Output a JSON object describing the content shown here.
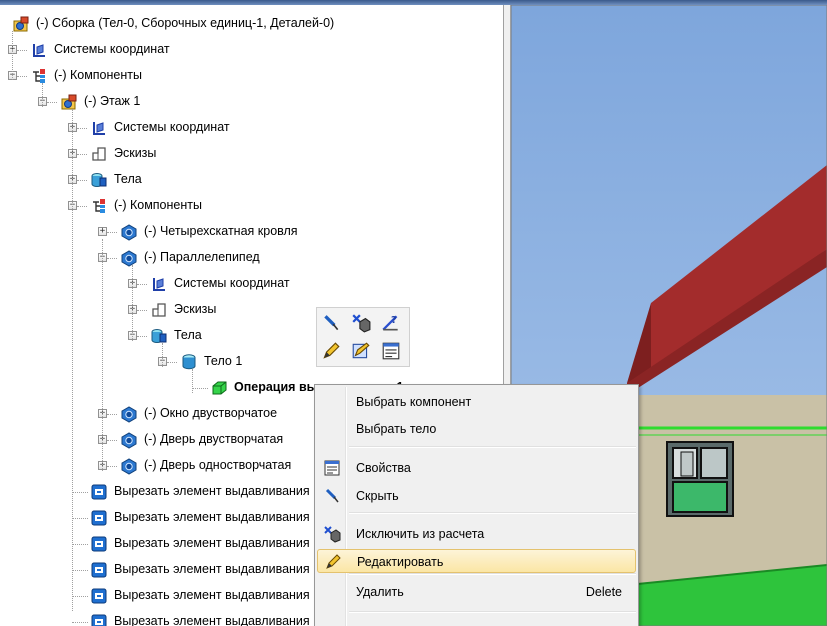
{
  "tree": {
    "root": "(-) Сборка (Тел-0, Сборочных единиц-1, Деталей-0)",
    "items": [
      {
        "label": "Системы координат"
      },
      {
        "label": "(-) Компоненты"
      },
      {
        "label": "(-) Этаж 1"
      },
      {
        "label": "Системы координат"
      },
      {
        "label": "Эскизы"
      },
      {
        "label": "Тела"
      },
      {
        "label": "(-) Компоненты"
      },
      {
        "label": "(-) Четырехскатная кровля"
      },
      {
        "label": "(-) Параллелепипед"
      },
      {
        "label": "Системы координат"
      },
      {
        "label": "Эскизы"
      },
      {
        "label": "Тела"
      },
      {
        "label": "Тело 1"
      },
      {
        "label": "Операция выдавливания:1"
      },
      {
        "label": "(-) Окно двустворчатое"
      },
      {
        "label": "(-) Дверь двустворчатая"
      },
      {
        "label": "(-) Дверь одностворчатая"
      },
      {
        "label": "Вырезать элемент выдавливания"
      },
      {
        "label": "Вырезать элемент выдавливания"
      },
      {
        "label": "Вырезать элемент выдавливания"
      },
      {
        "label": "Вырезать элемент выдавливания"
      },
      {
        "label": "Вырезать элемент выдавливания"
      },
      {
        "label": "Вырезать элемент выдавливания"
      }
    ]
  },
  "mini_toolbar": {
    "icons": [
      "pin-icon",
      "exclude-icon",
      "measure-icon",
      "pencil-icon",
      "edit-sketch-icon",
      "properties-icon"
    ]
  },
  "context_menu": {
    "items": [
      {
        "label": "Выбрать компонент",
        "icon": ""
      },
      {
        "label": "Выбрать тело",
        "icon": ""
      },
      {
        "label": "Свойства",
        "icon": "properties-icon"
      },
      {
        "label": "Скрыть",
        "icon": "pin-icon"
      },
      {
        "label": "Исключить из расчета",
        "icon": "exclude-icon"
      },
      {
        "label": "Редактировать",
        "icon": "pencil-icon",
        "highlighted": true
      },
      {
        "label": "Удалить",
        "shortcut": "Delete",
        "icon": ""
      }
    ]
  },
  "colors": {
    "sky": "#8fb3e2",
    "roof": "#9a2c2c",
    "wall": "#c7bfa4",
    "grass": "#2fbf3f",
    "highlight": "#fbe6a5"
  }
}
